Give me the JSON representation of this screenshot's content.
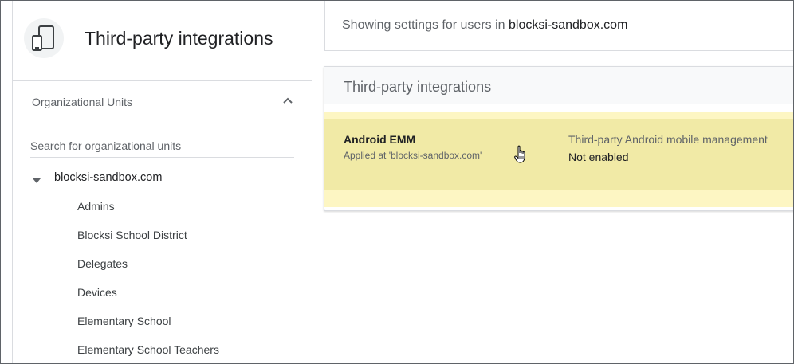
{
  "app": {
    "title": "Third-party integrations",
    "icon": "devices-icon"
  },
  "sidebar": {
    "ou_title": "Organizational Units",
    "ou_chevron_icon": "chevron-up-icon",
    "search_placeholder": "Search for organizational units",
    "search_value": "",
    "root": {
      "label": "blocksi-sandbox.com",
      "expanded": true,
      "caret_icon": "caret-down-icon"
    },
    "children": [
      {
        "label": "Admins"
      },
      {
        "label": "Blocksi School District"
      },
      {
        "label": "Delegates"
      },
      {
        "label": "Devices"
      },
      {
        "label": "Elementary School"
      },
      {
        "label": "Elementary School Teachers"
      }
    ]
  },
  "main": {
    "showing_prefix": "Showing settings for users in ",
    "showing_domain": "blocksi-sandbox.com",
    "card": {
      "title": "Third-party integrations",
      "settings": [
        {
          "name": "Android EMM",
          "applied": "Applied at 'blocksi-sandbox.com'",
          "description": "Third-party Android mobile management",
          "status": "Not enabled"
        }
      ]
    }
  },
  "colors": {
    "highlight_row": "#f1eaa6",
    "highlight_bg": "#fdf6c3",
    "border": "#dadce0",
    "text_secondary": "#5f6368"
  }
}
